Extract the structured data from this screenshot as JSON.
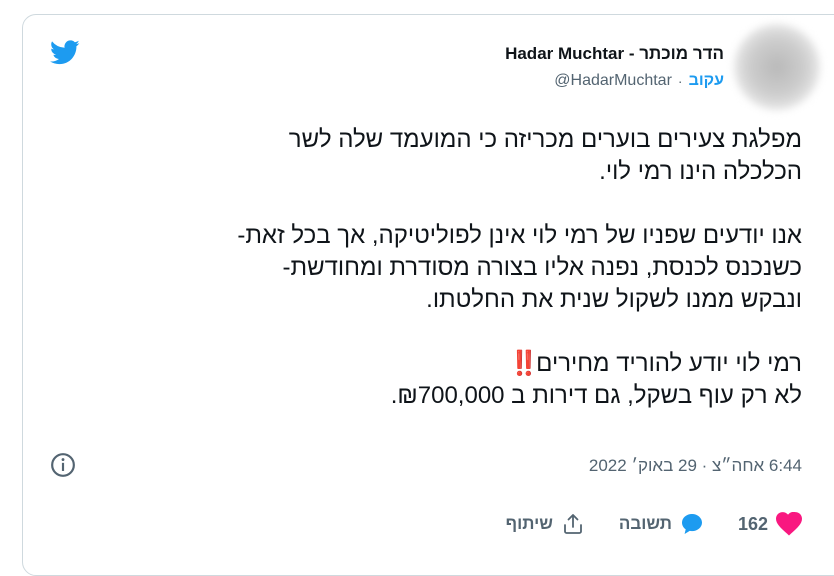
{
  "header": {
    "display_name": "Hadar Muchtar - הדר מוכתר",
    "handle": "@HadarMuchtar",
    "separator": "·",
    "follow_label": "עקוב"
  },
  "tweet": {
    "paragraphs": [
      [
        "מפלגת צעירים בוערים מכריזה כי המועמד שלה לשר",
        "הכלכלה הינו רמי לוי."
      ],
      [
        "אנו יודעים שפניו של רמי לוי אינן לפוליטיקה, אך בכל זאת-",
        "כשנכנס לכנסת, נפנה אליו בצורה מסודרת ומחודשת-",
        "ונבקש ממנו לשקול שנית את החלטתו."
      ]
    ],
    "last_paragraph": {
      "line1": "רמי לוי יודע להוריד מחירים",
      "line1_emoji": "‼️",
      "line2": "לא רק עוף בשקל, גם דירות ב ₪700,000."
    },
    "timestamp": "6:44 אחה״צ · 29 באוק׳ 2022"
  },
  "actions": {
    "like_count": "162",
    "reply_label": "תשובה",
    "share_label": "שיתוף"
  },
  "colors": {
    "accent": "#1d9bf0",
    "like": "#f91880",
    "text": "#0f1419",
    "muted": "#536471",
    "border": "#cfd9de"
  },
  "icons": [
    "twitter-logo-icon",
    "info-icon",
    "heart-icon",
    "reply-bubble-icon",
    "share-icon"
  ]
}
